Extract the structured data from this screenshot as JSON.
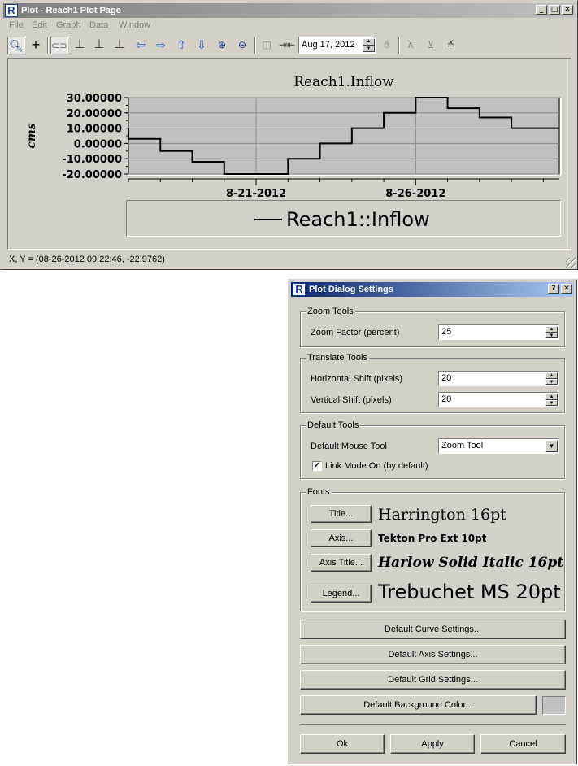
{
  "plot_window": {
    "title": "Plot - Reach1 Plot Page",
    "menu": [
      "File",
      "Edit",
      "Graph",
      "Data",
      "Window"
    ],
    "toolbar": {
      "tools": [
        "zoom-tool-icon",
        "crosshair-icon",
        "link-icon",
        "axis-icon",
        "axis-r-icon",
        "axis-s-icon",
        "pan-left-icon",
        "pan-right-icon",
        "pan-up-icon",
        "pan-down-icon",
        "zoom-in-icon",
        "zoom-out-icon"
      ],
      "date_value": "Aug 17, 2012"
    },
    "status": "X, Y = (08-26-2012 09:22:46, -22.9762)"
  },
  "chart_data": {
    "type": "line",
    "title": "Reach1.Inflow",
    "ylabel": "cms",
    "xlabel": "",
    "ylim": [
      -20,
      30
    ],
    "yticks": [
      "30.00000",
      "20.00000",
      "10.00000",
      "0.00000",
      "-10.00000",
      "-20.00000"
    ],
    "yticks_values": [
      30,
      20,
      10,
      0,
      -10,
      -20
    ],
    "xticks": [
      "8-21-2012",
      "8-26-2012"
    ],
    "xlim_days": [
      17,
      30.5
    ],
    "xticks_days": [
      21,
      26
    ],
    "grid": true,
    "legend": "bottom",
    "series": [
      {
        "name": "Reach1::Inflow",
        "color": "#000000",
        "steps": [
          {
            "x": 17.0,
            "y": 10
          },
          {
            "x": 17.0,
            "y": 3
          },
          {
            "x": 18.0,
            "y": -5
          },
          {
            "x": 19.0,
            "y": -12
          },
          {
            "x": 20.0,
            "y": -20
          },
          {
            "x": 21.0,
            "y": -20
          },
          {
            "x": 22.0,
            "y": -10
          },
          {
            "x": 23.0,
            "y": 0
          },
          {
            "x": 24.0,
            "y": 10
          },
          {
            "x": 25.0,
            "y": 20
          },
          {
            "x": 26.0,
            "y": 30
          },
          {
            "x": 27.0,
            "y": 23
          },
          {
            "x": 28.0,
            "y": 17
          },
          {
            "x": 29.0,
            "y": 10
          },
          {
            "x": 30.0,
            "y": 10
          }
        ]
      }
    ]
  },
  "dialog": {
    "title": "Plot Dialog Settings",
    "zoom": {
      "group": "Zoom Tools",
      "label": "Zoom Factor (percent)",
      "value": "25"
    },
    "translate": {
      "group": "Translate Tools",
      "h_label": "Horizontal Shift (pixels)",
      "h_value": "20",
      "v_label": "Vertical Shift (pixels)",
      "v_value": "20"
    },
    "defaults": {
      "group": "Default Tools",
      "mouse_label": "Default Mouse Tool",
      "mouse_value": "Zoom Tool",
      "link_label": "Link Mode On (by default)",
      "link_checked": true
    },
    "fonts": {
      "group": "Fonts",
      "rows": [
        {
          "button": "Title...",
          "sample": "Harrington 16pt"
        },
        {
          "button": "Axis...",
          "sample": "Tekton Pro Ext 10pt"
        },
        {
          "button": "Axis Title...",
          "sample": "Harlow Solid Italic 16pt"
        },
        {
          "button": "Legend...",
          "sample": "Trebuchet MS 20pt"
        }
      ]
    },
    "curve_btn": "Default Curve Settings...",
    "axis_btn": "Default Axis Settings...",
    "grid_btn": "Default Grid Settings...",
    "bg_btn": "Default Background Color...",
    "bg_color": "#c0c0c0",
    "ok": "Ok",
    "apply": "Apply",
    "cancel": "Cancel"
  }
}
